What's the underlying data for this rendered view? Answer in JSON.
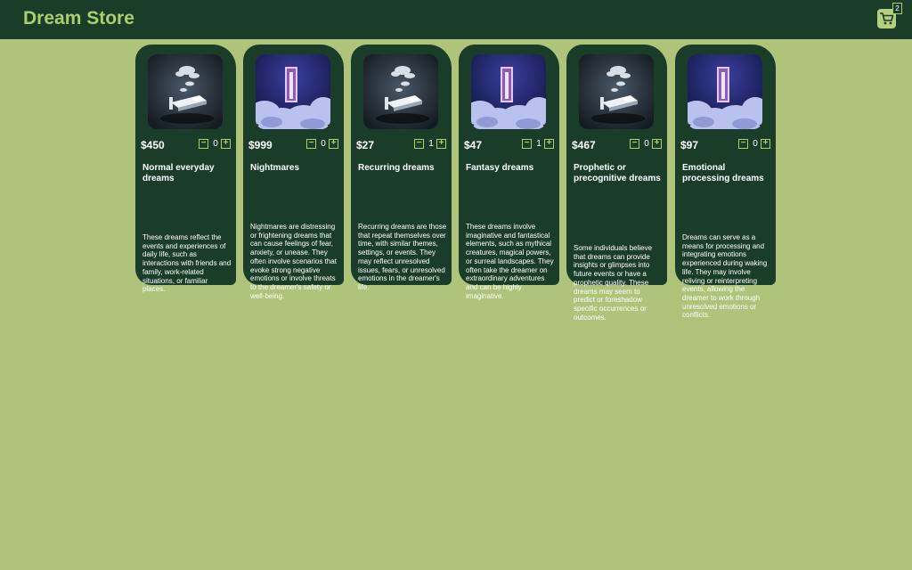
{
  "header": {
    "title": "Dream Store",
    "cart_count": "2",
    "accent_color": "#a9cf6e",
    "bar_color": "#1a3d2a"
  },
  "products": [
    {
      "price": "$450",
      "qty": "0",
      "name": "Normal everyday dreams",
      "description": "These dreams reflect the events and experiences of daily life, such as interactions with friends and family, work-related situations, or familiar places.",
      "image": "floating-bed-icon"
    },
    {
      "price": "$999",
      "qty": "0",
      "name": "Nightmares",
      "description": "Nightmares are distressing or frightening dreams that can cause feelings of fear, anxiety, or unease. They often involve scenarios that evoke strong negative emotions or involve threats to the dreamer's safety or well-being.",
      "image": "door-in-clouds-icon"
    },
    {
      "price": "$27",
      "qty": "1",
      "name": "Recurring dreams",
      "description": "Recurring dreams are those that repeat themselves over time, with similar themes, settings, or events. They may reflect unresolved issues, fears, or unresolved emotions in the dreamer's life.",
      "image": "floating-bed-icon"
    },
    {
      "price": "$47",
      "qty": "1",
      "name": "Fantasy dreams",
      "description": "These dreams involve imaginative and fantastical elements, such as mythical creatures, magical powers, or surreal landscapes. They often take the dreamer on extraordinary adventures and can be highly imaginative.",
      "image": "door-in-clouds-icon"
    },
    {
      "price": "$467",
      "qty": "0",
      "name": "Prophetic or precognitive dreams",
      "description": "Some individuals believe that dreams can provide insights or glimpses into future events or have a prophetic quality. These dreams may seem to predict or foreshadow specific occurrences or outcomes.",
      "image": "floating-bed-icon"
    },
    {
      "price": "$97",
      "qty": "0",
      "name": "Emotional processing dreams",
      "description": "Dreams can serve as a means for processing and integrating emotions experienced during waking life. They may involve reliving or reinterpreting events, allowing the dreamer to work through unresolved emotions or conflicts.",
      "image": "door-in-clouds-icon"
    }
  ]
}
